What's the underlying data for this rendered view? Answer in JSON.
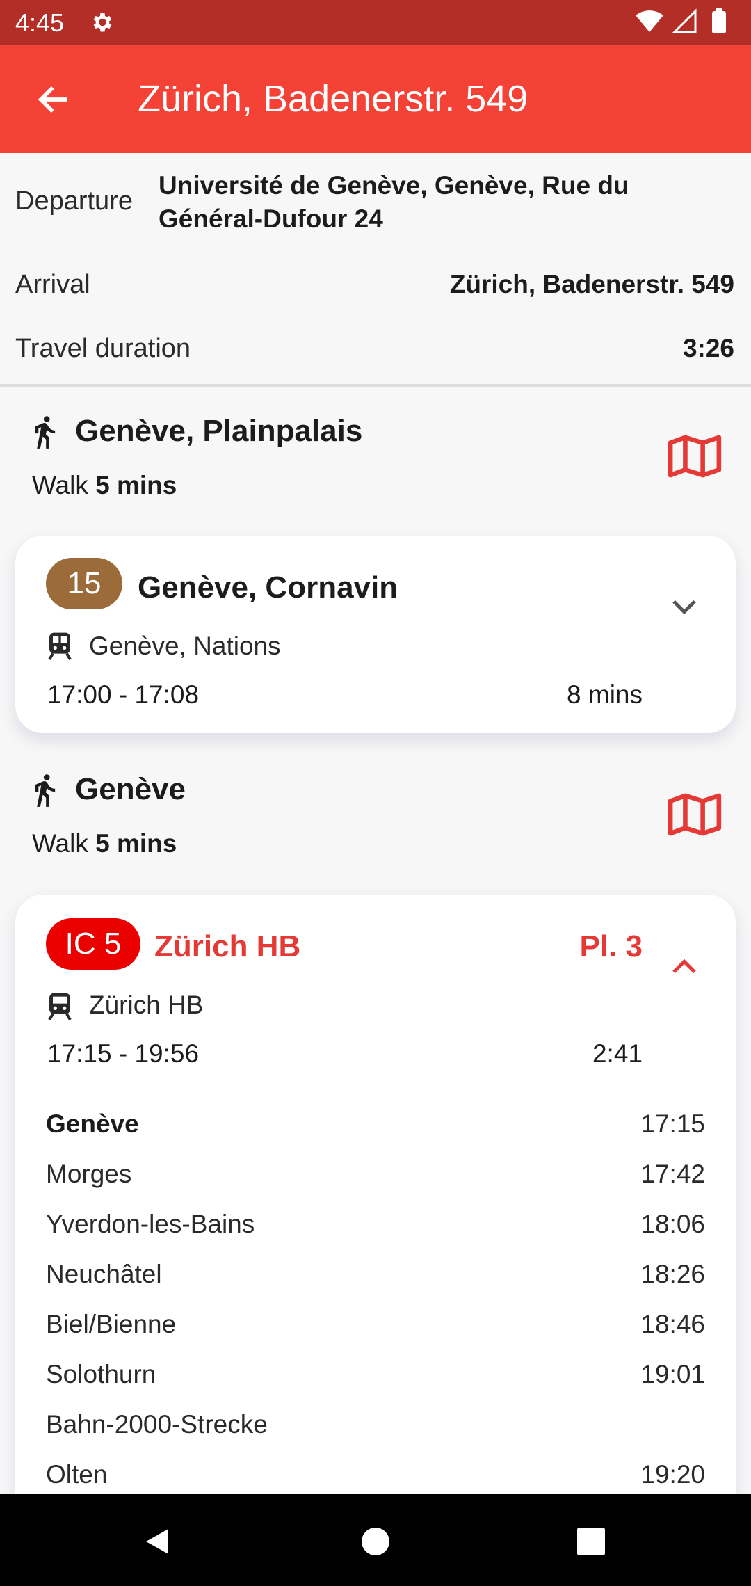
{
  "status_bar": {
    "time": "4:45"
  },
  "header": {
    "title": "Zürich, Badenerstr. 549"
  },
  "summary": {
    "departure_label": "Departure",
    "departure_value_line1": "Université de Genève, Genève, Rue du",
    "departure_value_line2": "Général-Dufour 24",
    "arrival_label": "Arrival",
    "arrival_value": "Zürich, Badenerstr. 549",
    "duration_label": "Travel duration",
    "duration_value": "3:26"
  },
  "walk1": {
    "destination": "Genève, Plainpalais",
    "prefix": "Walk",
    "duration": "5 mins"
  },
  "leg1": {
    "line": "15",
    "line_color": "#9c6b3a",
    "destination": "Genève, Cornavin",
    "stop": "Genève, Nations",
    "times": "17:00 - 17:08",
    "duration": "8 mins"
  },
  "walk2": {
    "destination": "Genève",
    "prefix": "Walk",
    "duration": "5 mins"
  },
  "leg2": {
    "line": "IC 5",
    "line_color": "#eb0000",
    "destination": "Zürich HB",
    "platform": "Pl. 3",
    "stop": "Zürich HB",
    "times": "17:15 - 19:56",
    "duration": "2:41",
    "stops": [
      {
        "name": "Genève",
        "time": "17:15"
      },
      {
        "name": "Morges",
        "time": "17:42"
      },
      {
        "name": "Yverdon-les-Bains",
        "time": "18:06"
      },
      {
        "name": "Neuchâtel",
        "time": "18:26"
      },
      {
        "name": "Biel/Bienne",
        "time": "18:46"
      },
      {
        "name": "Solothurn",
        "time": "19:01"
      },
      {
        "name": "Bahn-2000-Strecke",
        "time": ""
      },
      {
        "name": "Olten",
        "time": "19:20"
      }
    ]
  },
  "colors": {
    "accent": "#f44336",
    "status_bar": "#b22e27",
    "map_icon": "#e53935"
  }
}
